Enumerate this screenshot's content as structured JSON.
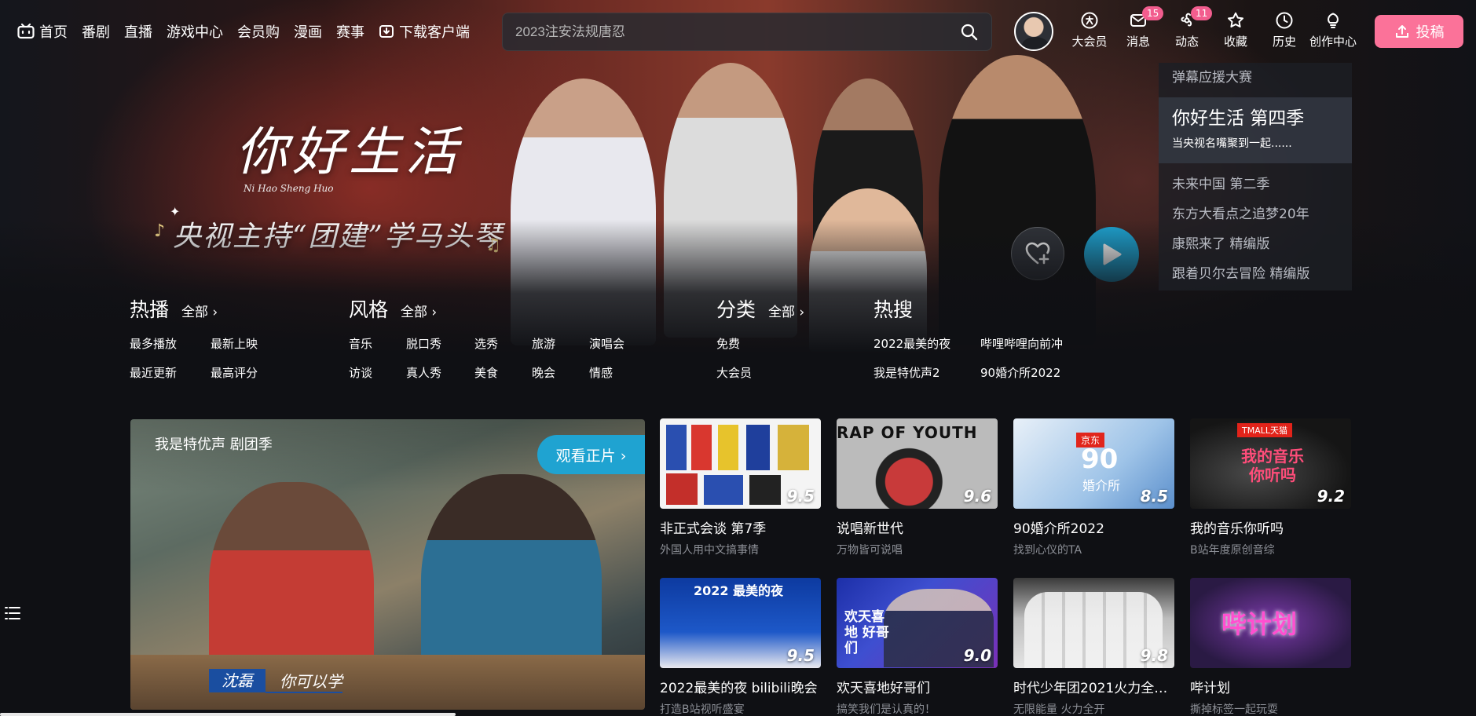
{
  "nav": {
    "items": [
      {
        "label": "首页",
        "icon": "tv-icon"
      },
      {
        "label": "番剧"
      },
      {
        "label": "直播"
      },
      {
        "label": "游戏中心"
      },
      {
        "label": "会员购"
      },
      {
        "label": "漫画"
      },
      {
        "label": "赛事"
      },
      {
        "label": "下载客户端",
        "icon": "download-icon"
      }
    ],
    "search_placeholder": "2023注安法规唐忍",
    "right": [
      {
        "label": "大会员",
        "icon": "vip-icon",
        "badge": ""
      },
      {
        "label": "消息",
        "icon": "message-icon",
        "badge": "15"
      },
      {
        "label": "动态",
        "icon": "dynamic-icon",
        "badge": "11"
      },
      {
        "label": "收藏",
        "icon": "star-icon",
        "badge": ""
      },
      {
        "label": "历史",
        "icon": "clock-icon",
        "badge": ""
      },
      {
        "label": "创作中心",
        "icon": "bulb-icon",
        "badge": ""
      }
    ],
    "upload_label": "投稿"
  },
  "hero": {
    "calligraphy": "你好生活",
    "calligraphy_sub": "Ni Hao Sheng Huo",
    "slogan": "央视主持“团建”学马头琴"
  },
  "side_list": {
    "top": "弹幕应援大赛",
    "active_title": "你好生活 第四季",
    "active_sub": "当央视名嘴聚到一起......",
    "rest": [
      "未来中国 第二季",
      "东方大看点之追梦20年",
      "康熙来了 精编版",
      "跟着贝尔去冒险 精编版"
    ]
  },
  "categories": [
    {
      "title": "热播",
      "all": "全部 ›",
      "items": [
        "最多播放",
        "最新上映",
        "最近更新",
        "最高评分"
      ]
    },
    {
      "title": "风格",
      "all": "全部 ›",
      "items": [
        "音乐",
        "脱口秀",
        "选秀",
        "旅游",
        "演唱会",
        "访谈",
        "真人秀",
        "美食",
        "晚会",
        "情感"
      ]
    },
    {
      "title": "分类",
      "all": "全部 ›",
      "items": [
        "免费",
        "大会员"
      ]
    },
    {
      "title": "热搜",
      "all": "",
      "items": [
        "2022最美的夜",
        "哔哩哔哩向前冲",
        "我是特优声2",
        "90婚介所2022"
      ]
    }
  ],
  "feature": {
    "title": "我是特优声 剧团季",
    "watch_label": "观看正片 ›",
    "caption_name": "沈磊",
    "caption_text": "你可以学"
  },
  "cards": [
    {
      "title": "非正式会谈 第7季",
      "sub": "外国人用中文搞事情",
      "score": "9.5"
    },
    {
      "title": "说唱新世代",
      "sub": "万物皆可说唱",
      "score": "9.6"
    },
    {
      "title": "90婚介所2022",
      "sub": "找到心仪的TA",
      "score": "8.5"
    },
    {
      "title": "我的音乐你听吗",
      "sub": "B站年度原创音综",
      "score": "9.2"
    },
    {
      "title": "2022最美的夜 bilibili晚会",
      "sub": "打造B站视听盛宴",
      "score": "9.5"
    },
    {
      "title": "欢天喜地好哥们",
      "sub": "搞笑我们是认真的！",
      "score": "9.0"
    },
    {
      "title": "时代少年团2021火力全开…",
      "sub": "无限能量 火力全开",
      "score": "9.8"
    },
    {
      "title": "哔计划",
      "sub": "撕掉标签一起玩耍",
      "score": ""
    }
  ],
  "thumb_texts": {
    "card3_brand": "京东",
    "card3_big": "90",
    "card3_small": "婚介所",
    "card4_brand": "TMALL天猫",
    "card4_big": "我的音乐 你听吗",
    "card5_top": "2022 最美的夜",
    "card6_big": "欢天喜地 好哥们",
    "card8_big": "哔计划",
    "card2_big": "RAP OF YOUTH"
  },
  "colors": {
    "accent_pink": "#fb7299",
    "accent_blue": "#1fa3d1",
    "badge": "#f25d8e",
    "bg": "#0f1014"
  }
}
